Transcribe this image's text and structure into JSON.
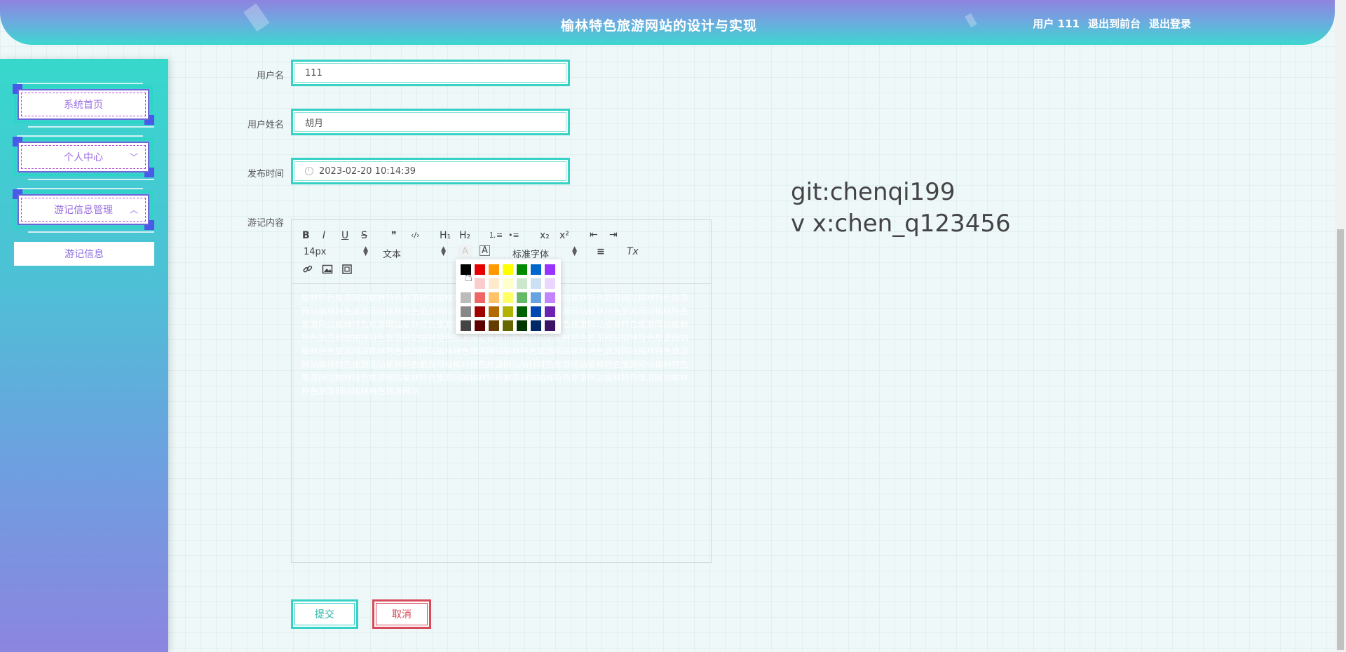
{
  "header": {
    "title": "榆林特色旅游网站的设计与实现",
    "nav": [
      "用户 111",
      "退出到前台",
      "退出登录"
    ]
  },
  "sidebar": {
    "items": [
      {
        "label": "系统首页"
      },
      {
        "label": "个人中心",
        "arrow": "﹀"
      },
      {
        "label": "游记信息管理",
        "arrow": "︿"
      }
    ],
    "submenu": [
      "游记信息"
    ]
  },
  "form": {
    "username": {
      "label": "用户名",
      "value": "111"
    },
    "realname": {
      "label": "用户姓名",
      "value": "胡月"
    },
    "publish_time": {
      "label": "发布时间",
      "value": "2023-02-20 10:14:39"
    },
    "content": {
      "label": "游记内容"
    }
  },
  "editor": {
    "toolbar": {
      "bold": "B",
      "italic": "I",
      "underline": "U",
      "strike": "S",
      "blockquote": "❞",
      "code": "‹/›",
      "h1": "H₁",
      "h2": "H₂",
      "ordered_list": "⒈≡",
      "bullet_list": "•≡",
      "sub": "x₂",
      "sup": "x²",
      "indent_out": "⇤",
      "indent_in": "⇥",
      "size": "14px",
      "header_select": "文本",
      "color": "A",
      "background": "A",
      "font": "标准字体",
      "align": "≡",
      "clean": "Tx"
    },
    "content_text": "榆林特色旅游网站榆林特色旅游网站榆林特色旅游网站榆林特色旅游网站榆林特色旅游网站榆林特色旅游网站榆林特色旅游网站榆林特色旅游网站榆林特色旅游网站榆林特色旅游网站榆林特色旅游网站榆林特色旅游网站榆林特色旅游网站榆林特色旅游网站榆林特色旅游网站榆林特色旅游网站榆林特色旅游网站榆林特色旅游网站榆林特色旅游网站榆林特色旅游网站榆林特色旅游网站榆林特色旅游网站榆林特色旅游网站榆林特色旅游网站榆林特色旅游网站榆林特色旅游网站榆林特色旅游网站榆林特色旅游网站榆林特色旅游网站榆林特色旅游网站榆林特色旅游网站榆林特色旅游网站榆林特色旅游网站榆林特色旅游网站榆林特色旅游网站榆林特色旅游网站榆林特色旅游网站榆林特色旅游网站榆林特色旅游网站榆林特色旅游网站榆林特色旅游网站榆林特色旅游网站",
    "color_palette": [
      [
        "#000000",
        "#e60000",
        "#ff9900",
        "#ffff00",
        "#008a00",
        "#0066cc",
        "#9933ff"
      ],
      [
        "#ffffff",
        "#facccc",
        "#ffebcc",
        "#ffffcc",
        "#cce8cc",
        "#cce0f5",
        "#ebd6ff"
      ],
      [
        "#bbbbbb",
        "#f06666",
        "#ffc266",
        "#ffff66",
        "#66b966",
        "#66a3e0",
        "#c285ff"
      ],
      [
        "#888888",
        "#a10000",
        "#b26b00",
        "#b2b200",
        "#006100",
        "#0047b2",
        "#6b24b2"
      ],
      [
        "#444444",
        "#5c0000",
        "#663d00",
        "#666600",
        "#003700",
        "#002966",
        "#3d1466"
      ]
    ]
  },
  "contact": {
    "line1": "git:chenqi199",
    "line2": "v x:chen_q123456"
  },
  "buttons": {
    "submit": "提交",
    "cancel": "取消"
  },
  "colors": {
    "accent": "#35d2c5",
    "menu_text": "#9a6ee0",
    "danger": "#d84a5a"
  }
}
